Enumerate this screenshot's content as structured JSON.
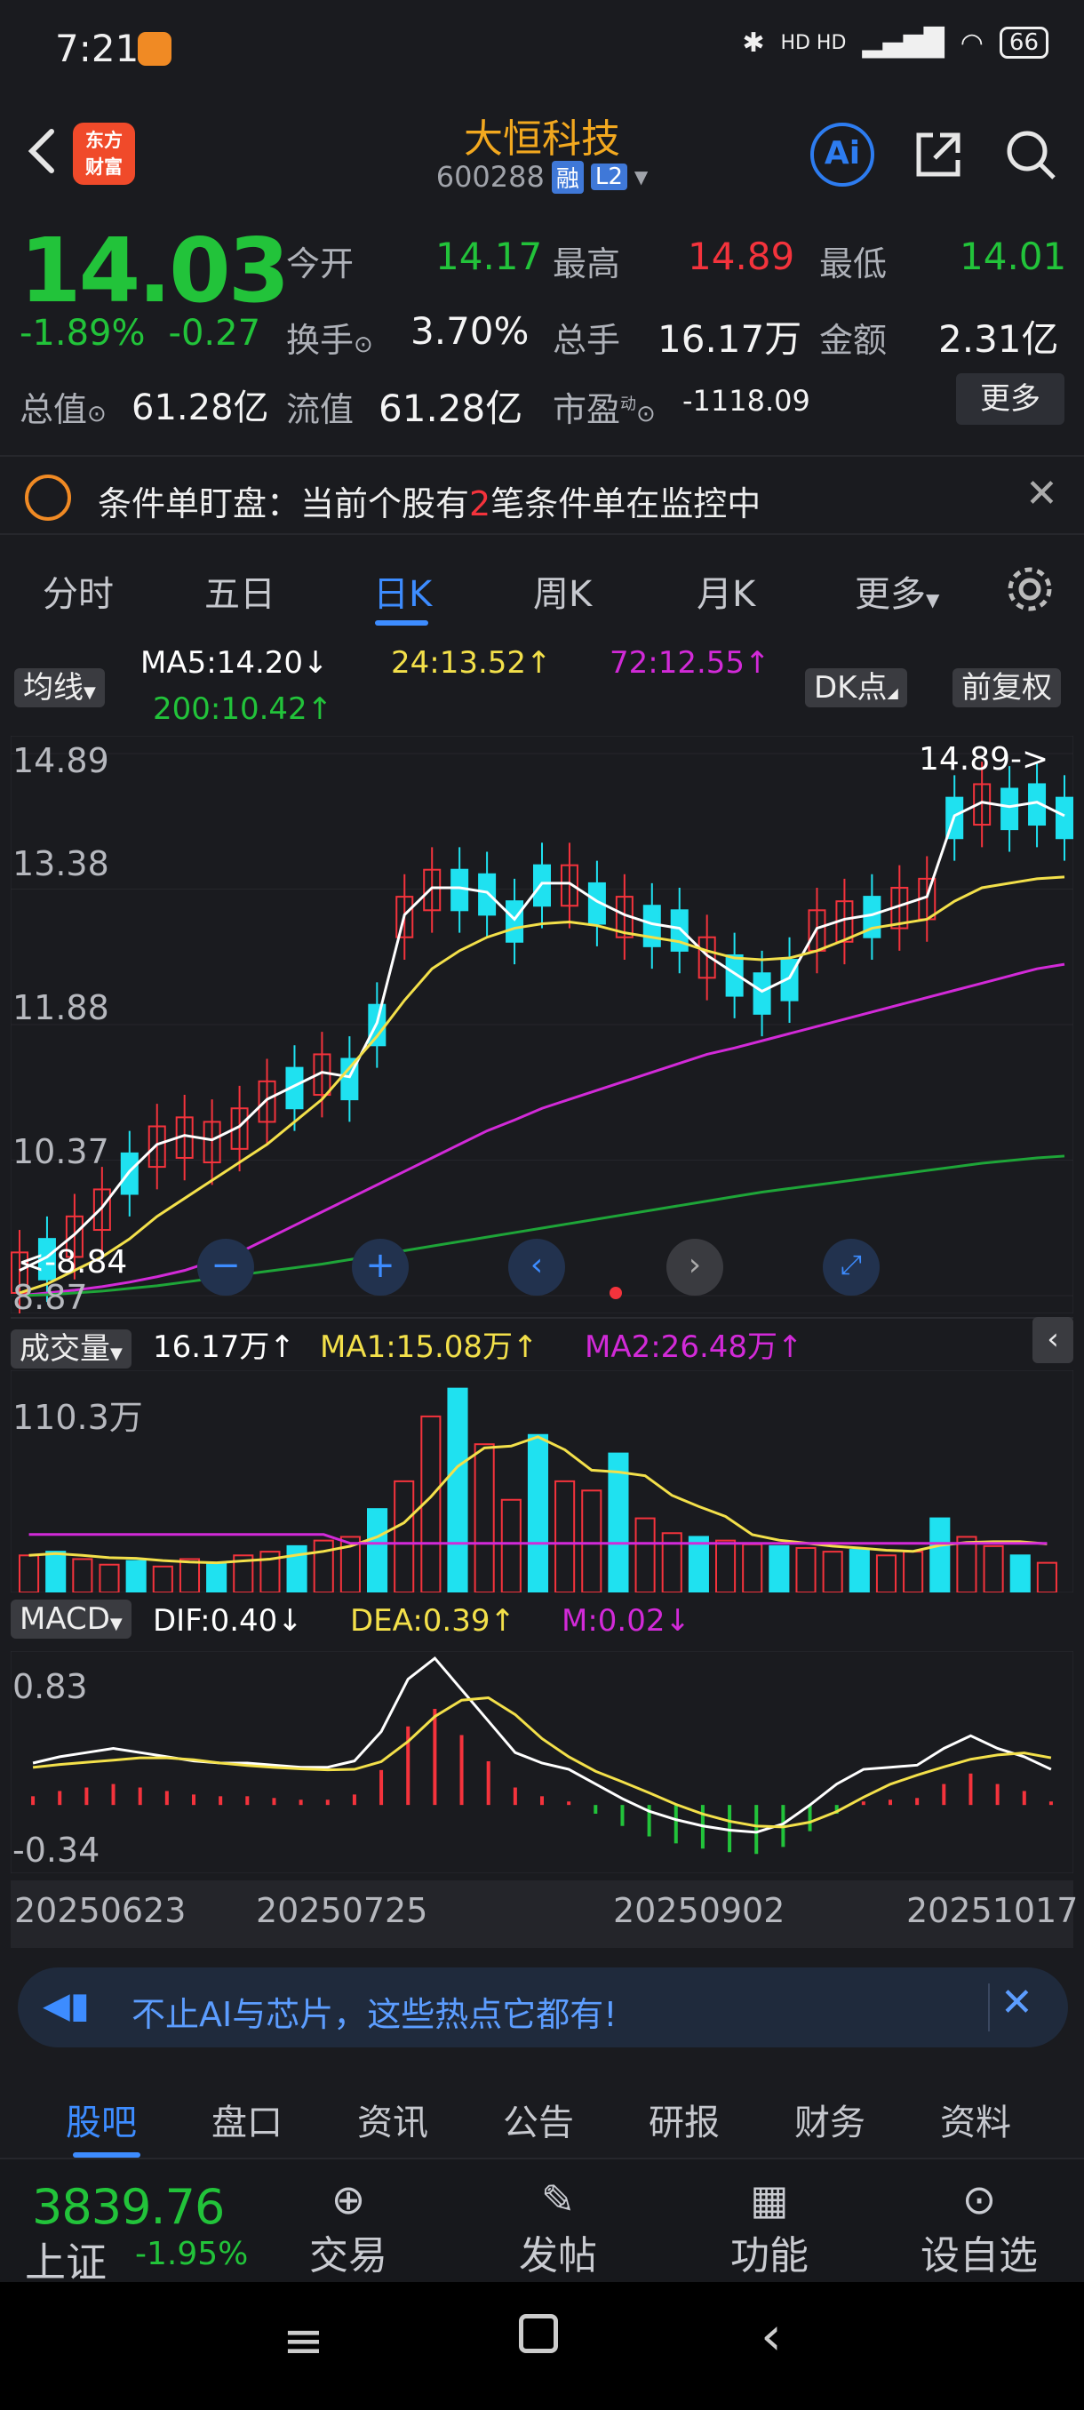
{
  "status_bar": {
    "time": "7:21",
    "signal_icons": "HD HD",
    "battery": "66"
  },
  "header": {
    "stock_name": "大恒科技",
    "stock_code": "600288",
    "tag_margin": "融",
    "tag_level": "L2",
    "logo_text_1": "东方",
    "logo_text_2": "财富",
    "ai_label": "Ai"
  },
  "quote": {
    "price": "14.03",
    "change_pct": "-1.89%",
    "change_abs": "-0.27",
    "open_label": "今开",
    "open": "14.17",
    "high_label": "最高",
    "high": "14.89",
    "low_label": "最低",
    "low": "14.01",
    "turnover_label": "换手",
    "turnover": "3.70%",
    "volume_label": "总手",
    "volume": "16.17万",
    "amount_label": "金额",
    "amount": "2.31亿",
    "mktcap_label": "总值",
    "mktcap": "61.28亿",
    "float_label": "流值",
    "float_cap": "61.28亿",
    "pe_label": "市盈",
    "pe_sup": "动",
    "pe": "-1118.09",
    "more_label": "更多"
  },
  "notice": {
    "prefix": "条件单盯盘：当前个股有",
    "count": "2",
    "suffix": "笔条件单在监控中"
  },
  "tabs": [
    "分时",
    "五日",
    "日K",
    "周K",
    "月K",
    "更多"
  ],
  "active_tab": "日K",
  "ma_row": {
    "selector": "均线",
    "ma5": "MA5:14.20",
    "ma24": "24:13.52",
    "ma72": "72:12.55",
    "ma200": "200:10.42",
    "dk_label": "DK点",
    "adjust_label": "前复权"
  },
  "colors": {
    "up": "#f4333c",
    "down": "#22c33a",
    "accent": "#3d8cff",
    "brand": "#f2a81f",
    "cyan": "#1fe1f0",
    "magenta": "#d22ad8",
    "yellow": "#f3e04a"
  },
  "chart_data": [
    {
      "type": "candlestick",
      "y_ticks": [
        "14.89",
        "13.38",
        "11.88",
        "10.37",
        "8.87"
      ],
      "ylim": [
        8.87,
        14.89
      ],
      "high_annotation": "14.89->",
      "low_annotation": "<-8.84",
      "x_ticks": [
        "20250623",
        "20250725",
        "20250902",
        "20251017"
      ],
      "series": [
        {
          "name": "MA5",
          "values": [
            9.15,
            9.3,
            9.55,
            9.85,
            10.25,
            10.55,
            10.65,
            10.6,
            10.75,
            11.05,
            11.2,
            11.35,
            11.3,
            11.9,
            13.1,
            13.4,
            13.4,
            13.35,
            13.05,
            13.45,
            13.45,
            13.25,
            13.1,
            13.0,
            12.95,
            12.65,
            12.45,
            12.25,
            12.4,
            12.95,
            13.05,
            13.1,
            13.2,
            13.3,
            14.2,
            14.35,
            14.3,
            14.35,
            14.2
          ]
        },
        {
          "name": "24",
          "values": [
            8.9,
            9.0,
            9.15,
            9.3,
            9.5,
            9.75,
            9.95,
            10.15,
            10.35,
            10.55,
            10.8,
            11.05,
            11.4,
            11.75,
            12.15,
            12.5,
            12.7,
            12.85,
            12.95,
            13.0,
            13.02,
            12.98,
            12.9,
            12.85,
            12.8,
            12.7,
            12.62,
            12.6,
            12.62,
            12.7,
            12.82,
            12.95,
            13.0,
            13.05,
            13.25,
            13.4,
            13.45,
            13.5,
            13.52
          ]
        },
        {
          "name": "72",
          "values": [
            8.87,
            8.9,
            8.93,
            8.97,
            9.02,
            9.08,
            9.15,
            9.25,
            9.35,
            9.5,
            9.65,
            9.8,
            9.95,
            10.1,
            10.25,
            10.4,
            10.55,
            10.7,
            10.82,
            10.95,
            11.05,
            11.15,
            11.25,
            11.35,
            11.45,
            11.55,
            11.62,
            11.7,
            11.78,
            11.86,
            11.94,
            12.02,
            12.1,
            12.18,
            12.26,
            12.34,
            12.42,
            12.5,
            12.55
          ]
        },
        {
          "name": "200",
          "values": [
            8.87,
            8.88,
            8.9,
            8.92,
            8.95,
            8.98,
            9.02,
            9.06,
            9.1,
            9.14,
            9.18,
            9.22,
            9.27,
            9.32,
            9.37,
            9.42,
            9.47,
            9.52,
            9.57,
            9.62,
            9.67,
            9.72,
            9.77,
            9.82,
            9.87,
            9.92,
            9.97,
            10.02,
            10.06,
            10.1,
            10.14,
            10.18,
            10.22,
            10.26,
            10.3,
            10.34,
            10.37,
            10.4,
            10.42
          ]
        }
      ]
    },
    {
      "type": "bar",
      "title": "成交量",
      "current": "16.17万",
      "ma1": "MA1:15.08万",
      "ma2": "MA2:26.48万",
      "y_ticks": [
        "110.3万"
      ],
      "values": [
        20,
        22,
        18,
        15,
        17,
        14,
        18,
        16,
        20,
        22,
        25,
        28,
        30,
        45,
        60,
        95,
        110,
        80,
        50,
        85,
        60,
        55,
        75,
        40,
        32,
        30,
        28,
        26,
        25,
        24,
        22,
        23,
        20,
        22,
        40,
        30,
        25,
        20,
        16
      ]
    },
    {
      "type": "bar",
      "title": "MACD",
      "dif": "DIF:0.40",
      "dea": "DEA:0.39",
      "m": "M:0.02",
      "y_ticks": [
        "0.83",
        "-0.34"
      ],
      "values": [
        0.05,
        0.08,
        0.1,
        0.12,
        0.1,
        0.08,
        0.06,
        0.05,
        0.05,
        0.04,
        0.03,
        0.03,
        0.06,
        0.2,
        0.45,
        0.55,
        0.4,
        0.25,
        0.1,
        0.05,
        0.02,
        -0.05,
        -0.12,
        -0.18,
        -0.22,
        -0.25,
        -0.27,
        -0.28,
        -0.24,
        -0.15,
        -0.05,
        0.02,
        0.03,
        0.04,
        0.12,
        0.18,
        0.12,
        0.08,
        0.02
      ]
    }
  ],
  "volume_row": {
    "selector": "成交量"
  },
  "macd_row": {
    "selector": "MACD"
  },
  "ad": {
    "text": "不止AI与芯片，这些热点它都有!"
  },
  "bottom_tabs": [
    "股吧",
    "盘口",
    "资讯",
    "公告",
    "研报",
    "财务",
    "资料"
  ],
  "index_widget": {
    "value": "3839.76",
    "name": "上证",
    "change": "-1.95%"
  },
  "toolbar": [
    "交易",
    "发帖",
    "功能",
    "设自选"
  ]
}
